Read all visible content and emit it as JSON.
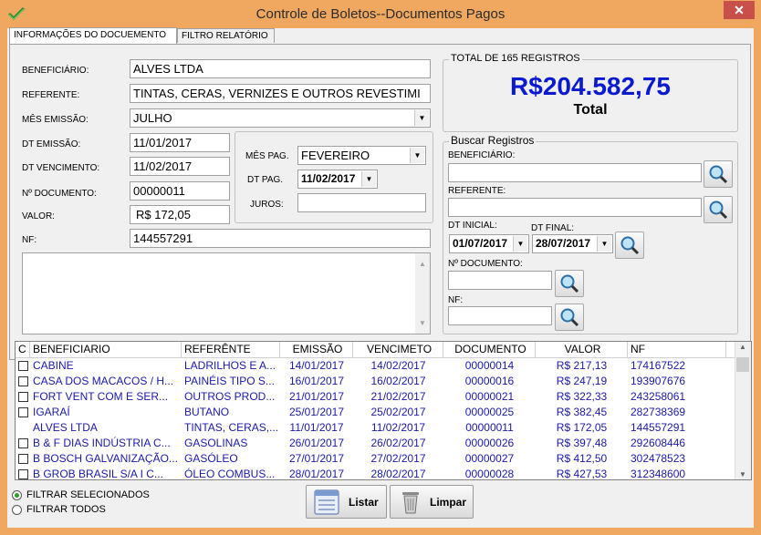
{
  "window": {
    "title": "Controle de Boletos--Documentos Pagos",
    "close_label": "✕",
    "accent": "#f0a860"
  },
  "tabs": [
    {
      "label": "INFORMAÇÕES DO DOCUEMENTO",
      "active": true
    },
    {
      "label": "FILTRO RELATÓRIO",
      "active": false
    }
  ],
  "form": {
    "beneficiario_label": "BENEFICIÁRIO:",
    "beneficiario_value": "ALVES LTDA",
    "referente_label": "REFERENTE:",
    "referente_value": "TINTAS, CERAS, VERNIZES E OUTROS REVESTIMI",
    "mes_emissao_label": "MÊS EMISSÃO:",
    "mes_emissao_value": "JULHO",
    "dt_emissao_label": "DT EMISSÃO:",
    "dt_emissao_value": "11/01/2017",
    "dt_vencimento_label": "DT VENCIMENTO:",
    "dt_vencimento_value": "11/02/2017",
    "n_documento_label": "Nº DOCUMENTO:",
    "n_documento_value": "00000011",
    "valor_label": "VALOR:",
    "valor_value": "R$ 172,05",
    "nf_label": "NF:",
    "nf_value": "144557291",
    "mes_pag_label": "MÊS PAG.",
    "mes_pag_value": "FEVEREIRO",
    "dt_pag_label": "DT PAG.",
    "dt_pag_value": "11/02/2017",
    "juros_label": "JUROS:",
    "juros_value": ""
  },
  "total": {
    "group_title": "TOTAL DE 165 REGISTROS",
    "amount": "R$204.582,75",
    "label": "Total"
  },
  "search": {
    "group_title": "Buscar Registros",
    "beneficiario_label": "BENEFICIÁRIO:",
    "referente_label": "REFERENTE:",
    "dt_inicial_label": "DT INICIAL:",
    "dt_inicial_value": "01/07/2017",
    "dt_final_label": "DT FINAL:",
    "dt_final_value": "28/07/2017",
    "n_documento_label": "Nº DOCUMENTO:",
    "nf_label": "NF:"
  },
  "grid": {
    "columns": [
      "C",
      "BENEFICIARIO",
      "REFERÊNTE",
      "EMISSÃO",
      "VENCIMETO",
      "DOCUMENTO",
      "VALOR",
      "NF"
    ],
    "rows": [
      {
        "check": true,
        "beneficiario": "CABINE",
        "referente": "LADRILHOS E A...",
        "emissao": "14/01/2017",
        "vencimento": "14/02/2017",
        "documento": "00000014",
        "valor": "R$ 217,13",
        "nf": "174167522"
      },
      {
        "check": true,
        "beneficiario": "CASA DOS MACACOS / H...",
        "referente": "PAINÉIS TIPO S...",
        "emissao": "16/01/2017",
        "vencimento": "16/02/2017",
        "documento": "00000016",
        "valor": "R$ 247,19",
        "nf": "193907676"
      },
      {
        "check": true,
        "beneficiario": "FORT VENT COM E SER...",
        "referente": "OUTROS PROD...",
        "emissao": "21/01/2017",
        "vencimento": "21/02/2017",
        "documento": "00000021",
        "valor": "R$ 322,33",
        "nf": "243258061"
      },
      {
        "check": true,
        "beneficiario": "IGARAÍ",
        "referente": "BUTANO",
        "emissao": "25/01/2017",
        "vencimento": "25/02/2017",
        "documento": "00000025",
        "valor": "R$ 382,45",
        "nf": "282738369"
      },
      {
        "check": false,
        "beneficiario": "ALVES LTDA",
        "referente": "TINTAS, CERAS,...",
        "emissao": "11/01/2017",
        "vencimento": "11/02/2017",
        "documento": "00000011",
        "valor": "R$ 172,05",
        "nf": "144557291"
      },
      {
        "check": true,
        "beneficiario": "B & F DIAS INDÚSTRIA C...",
        "referente": "GASOLINAS",
        "emissao": "26/01/2017",
        "vencimento": "26/02/2017",
        "documento": "00000026",
        "valor": "R$ 397,48",
        "nf": "292608446"
      },
      {
        "check": true,
        "beneficiario": "B BOSCH GALVANIZAÇÃO...",
        "referente": "GASÓLEO",
        "emissao": "27/01/2017",
        "vencimento": "27/02/2017",
        "documento": "00000027",
        "valor": "R$ 412,50",
        "nf": "302478523"
      },
      {
        "check": true,
        "beneficiario": "B GROB BRASIL S/A I C...",
        "referente": "ÓLEO COMBUS...",
        "emissao": "28/01/2017",
        "vencimento": "28/02/2017",
        "documento": "00000028",
        "valor": "R$ 427,53",
        "nf": "312348600"
      }
    ]
  },
  "filters": {
    "selected_label": "FILTRAR SELECIONADOS",
    "all_label": "FILTRAR TODOS",
    "selected_on": true
  },
  "buttons": {
    "listar": "Listar",
    "limpar": "Limpar"
  }
}
